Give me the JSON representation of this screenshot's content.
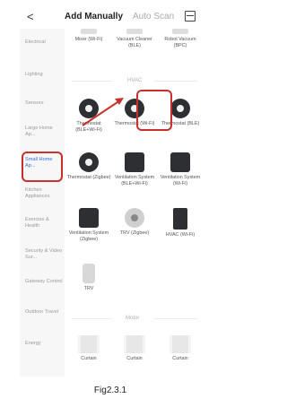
{
  "header": {
    "back": "<",
    "tab_active": "Add Manually",
    "tab_inactive": "Auto Scan"
  },
  "sidebar": [
    "Electrical",
    "Lighting",
    "Sensors",
    "Large Home Ap...",
    "Small Home Ap...",
    "Kitchen Appliances",
    "Exercise & Health",
    "Security & Video Sur...",
    "Gateway Control",
    "Outdoor Travel",
    "Energy"
  ],
  "top_row": [
    "Mixer (Wi-Fi)",
    "Vacuum Cleaner (BLE)",
    "Robot Vacuum (BPC)"
  ],
  "sections": {
    "hvac": "HVAC",
    "motor": "Motor"
  },
  "hvac_devices": [
    "Thermostat (BLE+Wi-Fi)",
    "Thermostat (Wi-Fi)",
    "Thermostat (BLE)",
    "Thermostat (Zigbee)",
    "Ventilation System (BLE+Wi-Fi)",
    "Ventilation System (Wi-Fi)",
    "Ventilation System (Zigbee)",
    "TRV (Zigbee)",
    "HVAC (Wi-Fi)",
    "TRV"
  ],
  "motor_devices": [
    "Curtain",
    "Curtain",
    "Curtain"
  ],
  "caption": "Fig2.3.1"
}
